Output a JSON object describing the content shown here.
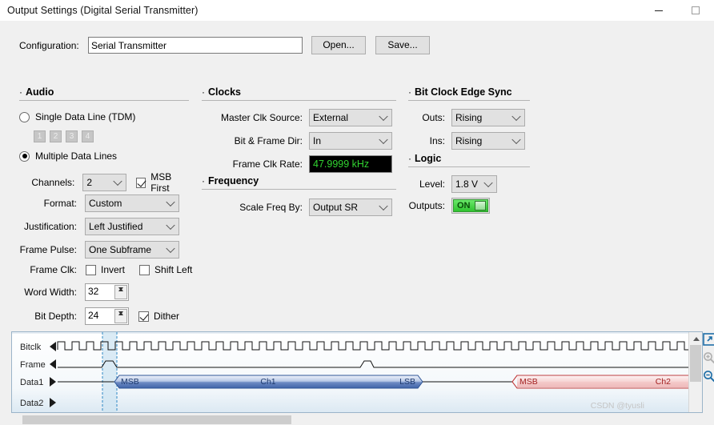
{
  "window": {
    "title": "Output Settings (Digital Serial Transmitter)",
    "minimize_label": "minimize",
    "maximize_label": "maximize"
  },
  "configuration": {
    "label": "Configuration:",
    "value": "Serial Transmitter",
    "placeholder": "",
    "open_button": "Open...",
    "save_button": "Save..."
  },
  "audio": {
    "title": "Audio",
    "bullet": "·",
    "single_data_line": {
      "label": "Single Data Line (TDM)",
      "selected": false,
      "line_buttons": [
        "1",
        "2",
        "3",
        "4"
      ]
    },
    "multiple_data_lines": {
      "label": "Multiple Data Lines",
      "selected": true
    },
    "channels": {
      "label": "Channels:",
      "value": "2"
    },
    "msb_first": {
      "label": "MSB First",
      "checked": true
    },
    "format": {
      "label": "Format:",
      "value": "Custom"
    },
    "justification": {
      "label": "Justification:",
      "value": "Left Justified"
    },
    "frame_pulse": {
      "label": "Frame Pulse:",
      "value": "One Subframe"
    },
    "frame_clk": {
      "label": "Frame Clk:",
      "invert": {
        "label": "Invert",
        "checked": false
      },
      "shift_left": {
        "label": "Shift Left",
        "checked": false
      }
    },
    "word_width": {
      "label": "Word Width:",
      "value": "32"
    },
    "bit_depth": {
      "label": "Bit Depth:",
      "value": "24"
    },
    "dither": {
      "label": "Dither",
      "checked": true
    }
  },
  "clocks": {
    "title": "Clocks",
    "master_clk_source": {
      "label": "Master Clk Source:",
      "value": "External"
    },
    "bit_frame_dir": {
      "label": "Bit & Frame Dir:",
      "value": "In"
    },
    "frame_clk_rate": {
      "label": "Frame Clk Rate:",
      "value": "47.9999 kHz",
      "text_color": "#31d431",
      "background_color": "#000000"
    }
  },
  "frequency": {
    "title": "Frequency",
    "scale_freq_by": {
      "label": "Scale Freq By:",
      "value": "Output SR"
    }
  },
  "bit_clock_edge_sync": {
    "title": "Bit Clock Edge Sync",
    "outs": {
      "label": "Outs:",
      "value": "Rising"
    },
    "ins": {
      "label": "Ins:",
      "value": "Rising"
    }
  },
  "logic": {
    "title": "Logic",
    "level": {
      "label": "Level:",
      "value": "1.8 V"
    },
    "outputs": {
      "label": "Outputs:",
      "value": "ON",
      "on": true,
      "color": "#2fc32f"
    }
  },
  "waveform": {
    "signals": [
      {
        "name": "Bitclk",
        "direction": "in"
      },
      {
        "name": "Frame",
        "direction": "in"
      },
      {
        "name": "Data1",
        "direction": "out"
      },
      {
        "name": "Data2",
        "direction": "out"
      }
    ],
    "data_blocks": [
      {
        "channel": "Ch1",
        "start_label": "MSB",
        "end_label": "LSB",
        "color": "#4a6fb0"
      },
      {
        "channel": "Ch2",
        "start_label": "MSB",
        "end_label": "",
        "color": "#cc3333"
      }
    ],
    "tools": [
      "expand-icon",
      "zoom-in-icon",
      "zoom-out-icon"
    ]
  },
  "watermark": {
    "text": "CSDN @tyusli"
  }
}
